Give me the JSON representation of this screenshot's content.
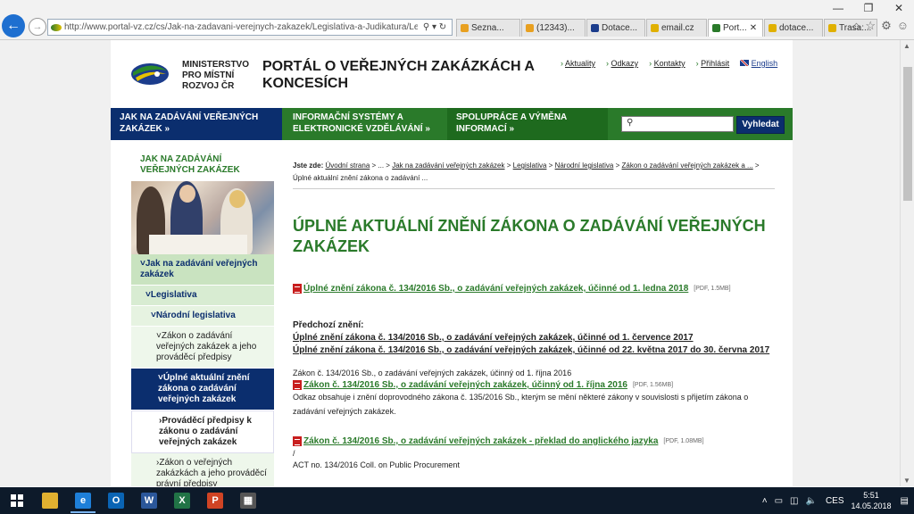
{
  "browser": {
    "url": "http://www.portal-vz.cz/cs/Jak-na-zadavani-verejnych-zakazek/Legislativa-a-Judikatura/Legislativa/",
    "tabs": [
      {
        "label": "Sezna...",
        "color": "#e8a020"
      },
      {
        "label": "(12343)...",
        "color": "#e8a020"
      },
      {
        "label": "Dotace...",
        "color": "#1b3c8c"
      },
      {
        "label": "email.cz",
        "color": "#e0b000"
      },
      {
        "label": "Port...",
        "color": "#2a7a2a",
        "active": true
      },
      {
        "label": "dotace...",
        "color": "#e0b000"
      },
      {
        "label": "Trasa:...",
        "color": "#e0b000"
      }
    ],
    "close_tab_glyph": "✕",
    "window_controls": [
      "—",
      "❐",
      "✕"
    ],
    "toolbar_icons": [
      "home-icon",
      "star-icon",
      "gear-icon",
      "smiley-icon"
    ]
  },
  "site": {
    "ministry_name": [
      "MINISTERSTVO",
      "PRO MÍSTNÍ",
      "ROZVOJ ČR"
    ],
    "portal_title": "PORTÁL O VEŘEJNÝCH ZAKÁZKÁCH A KONCESÍCH",
    "top_links": [
      {
        "label": "Aktuality"
      },
      {
        "label": "Odkazy"
      },
      {
        "label": "Kontakty"
      },
      {
        "label": "Přihlásit"
      },
      {
        "label": "English"
      }
    ],
    "menu": [
      {
        "label": "JAK NA ZADÁVÁNÍ VEŘEJNÝCH ZAKÁZEK »"
      },
      {
        "label": "INFORMAČNÍ SYSTÉMY A ELEKTRONICKÉ VZDĚLÁVÁNÍ »"
      },
      {
        "label": "SPOLUPRÁCE A VÝMĚNA INFORMACÍ »"
      }
    ],
    "search_placeholder": "",
    "search_button": "Vyhledat"
  },
  "sidebar": {
    "title": "JAK NA ZADÁVÁNÍ VEŘEJNÝCH ZAKÁZEK",
    "items": [
      {
        "label": "˅Jak na zadávání veřejných zakázek",
        "level": "l0"
      },
      {
        "label": "˅Legislativa",
        "level": "l1"
      },
      {
        "label": "˅Národní legislativa",
        "level": "l2"
      },
      {
        "label": "˅Zákon o zadávání veřejných zakázek a jeho prováděcí předpisy",
        "level": "l3"
      },
      {
        "label": "˅Úplné aktuální znění zákona o zadávání veřejných zakázek",
        "level": "active"
      },
      {
        "label": "›Prováděcí předpisy k zákonu o zadávání veřejných zakázek",
        "level": "l4"
      },
      {
        "label": "›Zákon o veřejných zakázkách a jeho prováděcí právní předpisy",
        "level": "l3"
      }
    ]
  },
  "content": {
    "breadcrumb_prefix": "Jste zde:",
    "breadcrumb": [
      "Úvodní strana",
      "...",
      "Jak na zadávání veřejných zakázek",
      "Legislativa",
      "Národní legislativa",
      "Zákon o zadávání veřejných zakázek a ...",
      "Úplné aktuální znění zákona o zadávání ..."
    ],
    "heading": "ÚPLNÉ AKTUÁLNÍ ZNĚNÍ ZÁKONA O ZADÁVÁNÍ VEŘEJNÝCH ZAKÁZEK",
    "main_doc": {
      "label": "Úplné znění zákona č. 134/2016 Sb., o zadávání veřejných zakázek, účinné od 1. ledna 2018",
      "meta": "[PDF, 1.5MB]"
    },
    "previous_label": "Předchozí znění:",
    "previous": [
      "Úplné znění zákona č. 134/2016 Sb., o zadávání veřejných zakázek, účinné od 1. července 2017",
      "Úplné znění zákona č. 134/2016 Sb., o zadávání veřejných zakázek, účinné od 22. května 2017 do 30. června 2017"
    ],
    "law_plain": "Zákon č. 134/2016 Sb., o zadávání veřejných zakázek, účinný od 1. října 2016",
    "law_doc": {
      "label": "Zákon č. 134/2016 Sb., o zadávání veřejných zakázek, účinný od 1. října 2016",
      "meta": "[PDF, 1.56MB]"
    },
    "law_note": "Odkaz obsahuje i znění doprovodného zákona č. 135/2016 Sb., kterým se mění některé zákony v souvislosti s přijetím zákona o zadávání veřejných zakázek.",
    "translation_doc": {
      "label": "Zákon č. 134/2016 Sb., o zadávání veřejných zakázek - překlad do anglického jazyka",
      "meta": "[PDF, 1.08MB]"
    },
    "slash": "/",
    "act_en": "ACT no. 134/2016 Coll.  on Public Procurement"
  },
  "taskbar": {
    "apps": [
      {
        "name": "file-explorer",
        "label": "",
        "color": "#e0b030"
      },
      {
        "name": "internet-explorer",
        "label": "e",
        "color": "#1e7fd8"
      },
      {
        "name": "outlook",
        "label": "O",
        "color": "#0a64b4"
      },
      {
        "name": "word",
        "label": "W",
        "color": "#2b579a"
      },
      {
        "name": "excel",
        "label": "X",
        "color": "#217346"
      },
      {
        "name": "powerpoint",
        "label": "P",
        "color": "#d04424"
      },
      {
        "name": "calculator",
        "label": "▦",
        "color": "#555"
      }
    ],
    "language": "CES",
    "time": "5:51",
    "date": "14.05.2018"
  }
}
